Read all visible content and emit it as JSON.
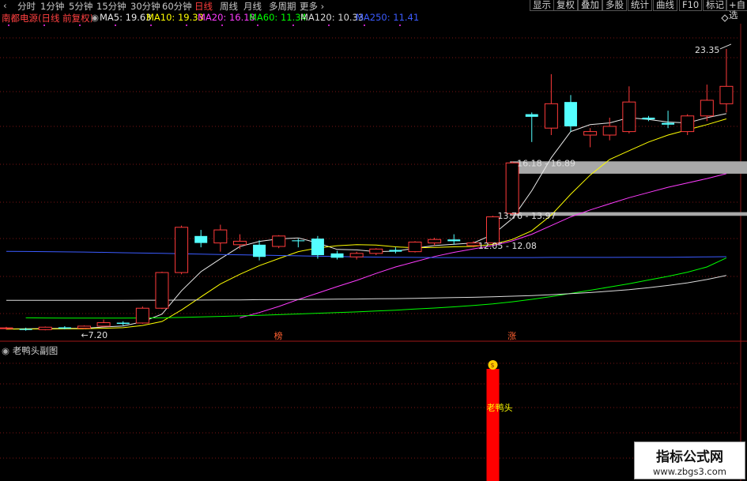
{
  "timeframes": [
    {
      "label": "分时",
      "selected": false
    },
    {
      "label": "1分钟",
      "selected": false
    },
    {
      "label": "5分钟",
      "selected": false
    },
    {
      "label": "15分钟",
      "selected": false
    },
    {
      "label": "30分钟",
      "selected": false
    },
    {
      "label": "60分钟",
      "selected": false
    },
    {
      "label": "日线",
      "selected": true
    },
    {
      "label": "周线",
      "selected": false
    },
    {
      "label": "月线",
      "selected": false
    },
    {
      "label": "多周期",
      "selected": false
    },
    {
      "label": "更多",
      "selected": false
    }
  ],
  "right_buttons": [
    "显示",
    "复权",
    "叠加",
    "多股",
    "统计",
    "曲线",
    "F10",
    "标记",
    "+自选"
  ],
  "info": {
    "stock_title": "南都电源(日线 前复权)",
    "ma": [
      {
        "label": "MA5: 19.63",
        "color": "#e8e8e8"
      },
      {
        "label": "MA10: 19.33",
        "color": "#ffff00"
      },
      {
        "label": "MA20: 16.18",
        "color": "#ff3cff"
      },
      {
        "label": "MA60: 11.34",
        "color": "#00ff00"
      },
      {
        "label": "MA120: 10.33",
        "color": "#dcdcdc"
      },
      {
        "label": "MA250: 11.41",
        "color": "#3b5bff"
      }
    ]
  },
  "subchart": {
    "title": "老鸭头副图",
    "bar_label": "老鸭头"
  },
  "watermark": {
    "line1": "指标公式网",
    "line2": "www.zbgs3.com"
  },
  "chart_data": {
    "type": "candlestick",
    "price_range": [
      6.6,
      24.8
    ],
    "grid": true,
    "candles": [
      {
        "o": 7.3,
        "h": 7.38,
        "l": 7.22,
        "c": 7.32
      },
      {
        "o": 7.26,
        "h": 7.33,
        "l": 7.16,
        "c": 7.2
      },
      {
        "o": 7.22,
        "h": 7.4,
        "l": 7.18,
        "c": 7.36
      },
      {
        "o": 7.35,
        "h": 7.42,
        "l": 7.24,
        "c": 7.28
      },
      {
        "o": 7.3,
        "h": 7.46,
        "l": 7.26,
        "c": 7.42
      },
      {
        "o": 7.42,
        "h": 7.8,
        "l": 7.38,
        "c": 7.62
      },
      {
        "o": 7.62,
        "h": 7.7,
        "l": 7.46,
        "c": 7.55
      },
      {
        "o": 7.6,
        "h": 8.55,
        "l": 7.56,
        "c": 8.45
      },
      {
        "o": 8.45,
        "h": 10.55,
        "l": 8.4,
        "c": 10.5
      },
      {
        "o": 10.5,
        "h": 13.2,
        "l": 10.4,
        "c": 13.1
      },
      {
        "o": 12.6,
        "h": 12.95,
        "l": 11.95,
        "c": 12.2
      },
      {
        "o": 12.2,
        "h": 13.25,
        "l": 11.7,
        "c": 12.95
      },
      {
        "o": 12.1,
        "h": 12.7,
        "l": 11.85,
        "c": 12.3
      },
      {
        "o": 12.1,
        "h": 12.35,
        "l": 11.2,
        "c": 11.4
      },
      {
        "o": 12.0,
        "h": 12.65,
        "l": 11.9,
        "c": 12.6
      },
      {
        "o": 12.35,
        "h": 12.45,
        "l": 11.95,
        "c": 12.3
      },
      {
        "o": 12.45,
        "h": 12.6,
        "l": 11.3,
        "c": 11.5
      },
      {
        "o": 11.6,
        "h": 11.75,
        "l": 11.25,
        "c": 11.35
      },
      {
        "o": 11.4,
        "h": 11.7,
        "l": 11.25,
        "c": 11.6
      },
      {
        "o": 11.6,
        "h": 11.9,
        "l": 11.5,
        "c": 11.85
      },
      {
        "o": 11.8,
        "h": 11.95,
        "l": 11.6,
        "c": 11.7
      },
      {
        "o": 11.7,
        "h": 12.3,
        "l": 11.65,
        "c": 12.25
      },
      {
        "o": 12.2,
        "h": 12.5,
        "l": 12.05,
        "c": 12.4
      },
      {
        "o": 12.4,
        "h": 12.7,
        "l": 12.1,
        "c": 12.3
      },
      {
        "o": 12.05,
        "h": 12.3,
        "l": 11.95,
        "c": 12.2
      },
      {
        "o": 12.2,
        "h": 13.76,
        "l": 12.05,
        "c": 13.7
      },
      {
        "o": 13.9,
        "h": 16.89,
        "l": 13.8,
        "c": 16.8
      },
      {
        "o": 19.6,
        "h": 19.7,
        "l": 18.0,
        "c": 19.45
      },
      {
        "o": 18.8,
        "h": 21.9,
        "l": 18.4,
        "c": 20.2
      },
      {
        "o": 20.3,
        "h": 20.7,
        "l": 18.6,
        "c": 18.9
      },
      {
        "o": 18.4,
        "h": 18.8,
        "l": 17.7,
        "c": 18.6
      },
      {
        "o": 18.4,
        "h": 19.4,
        "l": 18.1,
        "c": 18.9
      },
      {
        "o": 18.6,
        "h": 21.2,
        "l": 18.5,
        "c": 20.3
      },
      {
        "o": 19.4,
        "h": 19.5,
        "l": 19.2,
        "c": 19.3
      },
      {
        "o": 19.1,
        "h": 19.8,
        "l": 18.8,
        "c": 19.0
      },
      {
        "o": 18.6,
        "h": 19.6,
        "l": 18.4,
        "c": 19.5
      },
      {
        "o": 19.5,
        "h": 21.3,
        "l": 19.2,
        "c": 20.4
      },
      {
        "o": 20.2,
        "h": 23.35,
        "l": 19.7,
        "c": 21.2
      }
    ],
    "ma_lines": [
      {
        "name": "MA5",
        "color": "#e8e8e8",
        "values": [
          7.26,
          7.27,
          7.28,
          7.29,
          7.3,
          7.37,
          7.43,
          7.67,
          8.11,
          9.45,
          10.55,
          11.29,
          11.99,
          12.29,
          12.43,
          12.49,
          12.2,
          11.83,
          11.8,
          11.7,
          11.73,
          11.9,
          12.05,
          12.13,
          12.2,
          12.68,
          13.6,
          15.2,
          17.1,
          18.6,
          19.0,
          19.1,
          19.4,
          19.3,
          19.15,
          19.1,
          19.4,
          19.63
        ]
      },
      {
        "name": "MA10",
        "color": "#ffff00",
        "values": [
          7.25,
          7.26,
          7.26,
          7.27,
          7.27,
          7.3,
          7.33,
          7.46,
          7.69,
          8.35,
          9.1,
          9.84,
          10.4,
          10.9,
          11.3,
          11.7,
          11.91,
          12.04,
          12.1,
          12.08,
          11.98,
          11.92,
          11.94,
          11.98,
          12.0,
          12.12,
          12.4,
          12.9,
          13.8,
          15.0,
          16.1,
          17.0,
          17.5,
          18.0,
          18.4,
          18.7,
          19.0,
          19.33
        ]
      },
      {
        "name": "MA20",
        "color": "#ff3cff",
        "values": [
          null,
          null,
          null,
          null,
          null,
          null,
          null,
          null,
          null,
          null,
          null,
          null,
          7.9,
          8.2,
          8.55,
          8.95,
          9.32,
          9.69,
          10.05,
          10.45,
          10.82,
          11.12,
          11.42,
          11.66,
          11.86,
          12.05,
          12.32,
          12.7,
          13.2,
          13.7,
          14.1,
          14.45,
          14.8,
          15.1,
          15.4,
          15.65,
          15.9,
          16.18
        ]
      },
      {
        "name": "MA60",
        "color": "#00ff00",
        "values": [
          null,
          7.9,
          7.89,
          7.88,
          7.88,
          7.88,
          7.88,
          7.89,
          7.9,
          7.92,
          7.95,
          7.98,
          8.01,
          8.04,
          8.08,
          8.12,
          8.16,
          8.2,
          8.24,
          8.29,
          8.34,
          8.4,
          8.46,
          8.53,
          8.61,
          8.7,
          8.82,
          8.96,
          9.12,
          9.3,
          9.48,
          9.67,
          9.86,
          10.07,
          10.28,
          10.52,
          10.82,
          11.34
        ]
      },
      {
        "name": "MA120",
        "color": "#dcdcdc",
        "values": [
          8.9,
          8.9,
          8.9,
          8.9,
          8.9,
          8.9,
          8.9,
          8.91,
          8.91,
          8.92,
          8.92,
          8.93,
          8.93,
          8.94,
          8.94,
          8.95,
          8.96,
          8.97,
          8.98,
          8.99,
          9.0,
          9.02,
          9.04,
          9.06,
          9.08,
          9.11,
          9.14,
          9.18,
          9.23,
          9.29,
          9.35,
          9.43,
          9.52,
          9.63,
          9.76,
          9.91,
          10.1,
          10.33
        ]
      },
      {
        "name": "MA250",
        "color": "#3b5bff",
        "values": [
          11.72,
          11.71,
          11.7,
          11.69,
          11.68,
          11.66,
          11.64,
          11.62,
          11.6,
          11.58,
          11.56,
          11.54,
          11.52,
          11.5,
          11.48,
          11.46,
          11.44,
          11.42,
          11.4,
          11.39,
          11.38,
          11.37,
          11.36,
          11.36,
          11.36,
          11.36,
          11.36,
          11.36,
          11.37,
          11.37,
          11.37,
          11.37,
          11.38,
          11.38,
          11.38,
          11.39,
          11.4,
          11.41
        ]
      }
    ],
    "annotations": [
      {
        "text": "←7.20",
        "price": 7.2,
        "index": 4
      },
      {
        "text": "23.35",
        "price": 23.35,
        "index": 37
      },
      {
        "text": "16.18 - 16.89",
        "price": 16.8,
        "index": 26
      },
      {
        "text": "13.76 - 13.97",
        "price": 13.76,
        "index": 25
      },
      {
        "text": "12.05 - 12.08",
        "price": 12.05,
        "index": 24
      }
    ],
    "gray_bands": [
      [
        16.18,
        16.89
      ],
      [
        13.76,
        13.97
      ]
    ],
    "markers": [
      {
        "text": "榜",
        "index": 14
      },
      {
        "text": "涨",
        "index": 26
      }
    ],
    "subchart_signal": {
      "index": 25,
      "label": "老鸭头"
    }
  }
}
